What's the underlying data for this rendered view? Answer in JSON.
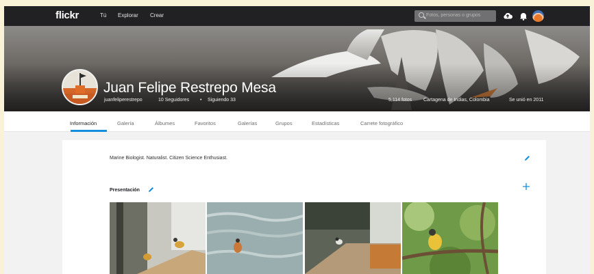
{
  "topnav": {
    "logo": "flickr",
    "links": [
      "Tú",
      "Explorar",
      "Crear"
    ],
    "search_placeholder": "Fotos, personas o grupos"
  },
  "profile": {
    "name": "Juan Felipe Restrepo Mesa",
    "username": "juanfeliperestrepo",
    "followers": "10 Seguidores",
    "following": "Siguiendo 33",
    "separator": "•",
    "photos": "5,114 fotos",
    "location": "Cartagena de Indias, Colombia",
    "joined": "Se unió en 2011"
  },
  "tabs": [
    "Información",
    "Galería",
    "Álbumes",
    "Favoritos",
    "Galerías",
    "Grupos",
    "Estadísticas",
    "Carrete fotográfico"
  ],
  "about": {
    "bio": "Marine Biologist. Naturalist. Citizen Science Enthusiast.",
    "showcase_title": "Presentación"
  },
  "colors": {
    "accent": "#128fdc",
    "nav_bg": "#212124",
    "background": "#f9f1d8"
  },
  "icons": [
    "search-icon",
    "upload-icon",
    "bell-icon",
    "pencil-icon",
    "plus-icon"
  ]
}
